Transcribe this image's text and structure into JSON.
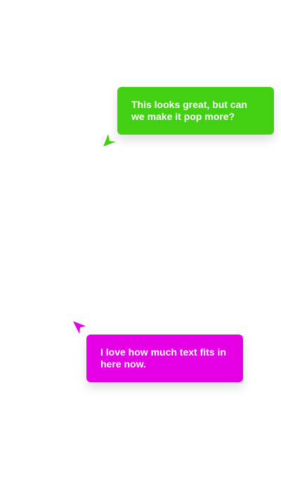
{
  "collaborators": [
    {
      "color": "#41d012",
      "cursor_icon": "arrow-cursor-icon",
      "message": "This looks great, but can we make it pop more?"
    },
    {
      "color": "#e600e6",
      "cursor_icon": "arrow-cursor-icon",
      "message": "I love how much text fits in here now."
    }
  ]
}
